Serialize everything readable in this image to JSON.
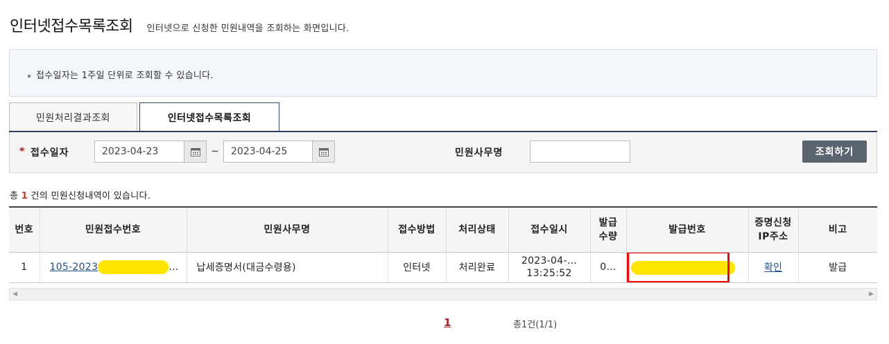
{
  "page": {
    "title": "인터넷접수목록조회",
    "description": "인터넷으로 신청한 민원내역을 조회하는 화면입니다."
  },
  "notice": {
    "text": "접수일자는 1주일 단위로 조회할 수 있습니다."
  },
  "tabs": [
    {
      "label": "민원처리결과조회",
      "active": false
    },
    {
      "label": "인터넷접수목록조회",
      "active": true
    }
  ],
  "search": {
    "required_mark": "*",
    "date_label": "접수일자",
    "date_from": "2023-04-23",
    "date_to": "2023-04-25",
    "range_sep": "~",
    "office_label": "민원사무명",
    "office_value": "",
    "button_label": "조회하기",
    "calendar_icon": "calendar-icon"
  },
  "summary": {
    "prefix": "총",
    "count": "1",
    "suffix": "건의 민원신청내역이 있습니다."
  },
  "table": {
    "headers": [
      "번호",
      "민원접수번호",
      "민원사무명",
      "접수방법",
      "처리상태",
      "접수일시",
      "발급\n수량",
      "발급번호",
      "증명신청\nIP주소",
      "비고"
    ],
    "rows": [
      {
        "no": "1",
        "receipt_no": "105-2023",
        "receipt_ellipsis": "…",
        "office": "납세증명서(대금수령용)",
        "method": "인터넷",
        "status": "처리완료",
        "date": "2023-04-…",
        "time": "13:25:52",
        "qty": "0…",
        "issue_no": "",
        "ip": "확인",
        "note": "발급"
      }
    ]
  },
  "pagination": {
    "current": "1",
    "info": "총1건(1/1)"
  },
  "colors": {
    "accent": "#2c3f60",
    "button": "#5b6570",
    "highlight": "#ffe600",
    "annotation": "#ff0000",
    "link": "#1f4e8c"
  }
}
